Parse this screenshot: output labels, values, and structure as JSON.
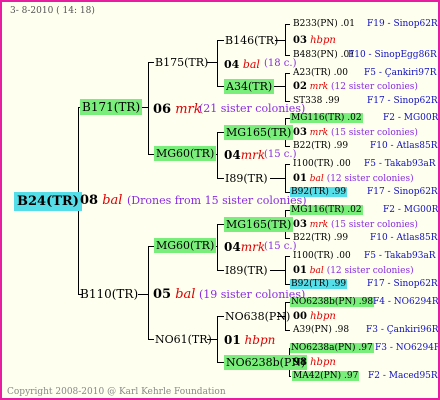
{
  "header_date": "3-  8-2010 ( 14: 18)",
  "copyright": "Copyright 2008-2010 @ Karl Kehrle Foundation",
  "root": {
    "id": "B24(TR)",
    "num": "08",
    "mark": "bal",
    "note": "(Drones from 15 sister colonies)"
  },
  "g1": [
    {
      "id": "B171(TR)",
      "num": "06",
      "mark": "mrk",
      "note": "(21 sister colonies)"
    },
    {
      "id": "B110(TR)",
      "num": "05",
      "mark": "bal",
      "note": "(19 sister colonies)"
    }
  ],
  "g2": [
    {
      "id": "B175(TR)"
    },
    {
      "id": "MG60(TR)",
      "num": "04",
      "mark": "mrk",
      "note": "(15 c.)"
    },
    {
      "id": "MG60(TR)",
      "num": "04",
      "mark": "mrk",
      "note": "(15 c.)"
    },
    {
      "id": "NO61(TR)",
      "num": "01",
      "mark": "hbpn"
    }
  ],
  "g3": [
    {
      "id": "B146(TR)",
      "num": "04",
      "mark": "bal",
      "note": "(18 c.)"
    },
    {
      "id": "A34(TR)",
      "num": "02",
      "mark": "mrk",
      "note": "(12 sister colonies)"
    },
    {
      "id": "MG165(TR)",
      "num": "03",
      "mark": "mrk",
      "note": "(15 sister colonies)"
    },
    {
      "id": "I89(TR)",
      "num": "01",
      "mark": "bal",
      "note": "(12 sister colonies)"
    },
    {
      "id": "MG165(TR)",
      "num": "03",
      "mark": "mrk",
      "note": "(15 sister colonies)"
    },
    {
      "id": "I89(TR)",
      "num": "01",
      "mark": "bal",
      "note": "(12 sister colonies)"
    },
    {
      "id": "NO638(PN)",
      "num": "00",
      "mark": "hbpn"
    },
    {
      "id": "NO6238b(PN)",
      "num": "98",
      "mark": "hbpn"
    }
  ],
  "g4": [
    {
      "id": "B233(PN)",
      "year": ".01",
      "ref": "F19 - Sinop62R"
    },
    {
      "id": "B483(PN)",
      "year": ".01",
      "ref": "F10 - SinopEgg86R"
    },
    {
      "id": "A23(TR)",
      "year": ".00",
      "ref": "F5 - Çankiri97R"
    },
    {
      "id": "ST338",
      "year": ".99",
      "ref": "F17 - Sinop62R"
    },
    {
      "id": "MG116(TR)",
      "year": ".02",
      "ref": "F2 - MG00R"
    },
    {
      "id": "B22(TR)",
      "year": ".99",
      "ref": "F10 - Atlas85R"
    },
    {
      "id": "I100(TR)",
      "year": ".00",
      "ref": "F5 - Takab93aR"
    },
    {
      "id": "B92(TR)",
      "year": ".99",
      "ref": "F17 - Sinop62R"
    },
    {
      "id": "MG116(TR)",
      "year": ".02",
      "ref": "F2 - MG00R"
    },
    {
      "id": "B22(TR)",
      "year": ".99",
      "ref": "F10 - Atlas85R"
    },
    {
      "id": "I100(TR)",
      "year": ".00",
      "ref": "F5 - Takab93aR"
    },
    {
      "id": "B92(TR)",
      "year": ".99",
      "ref": "F17 - Sinop62R"
    },
    {
      "id": "NO6238b(PN)",
      "year": ".98",
      "ref": "F4 - NO6294R"
    },
    {
      "id": "A39(PN)",
      "year": ".98",
      "ref": "F3 - Çankiri96R"
    },
    {
      "id": "NO6238a(PN)",
      "year": ".97",
      "ref": "F3 - NO6294R"
    },
    {
      "id": "MA42(PN)",
      "year": ".97",
      "ref": "F2 - Maced95R"
    }
  ]
}
